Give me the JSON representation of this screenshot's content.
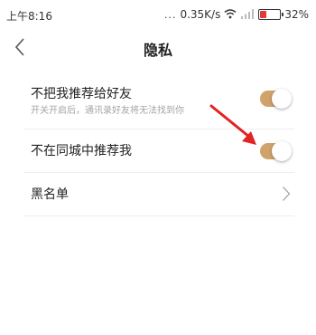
{
  "status_bar": {
    "time": "上午8:16",
    "dots": "...",
    "network_speed": "0.35K/s",
    "battery_percent": "32%",
    "battery_level": 0.32,
    "battery_color": "#e03a3a",
    "icons": [
      "wifi-icon",
      "signal-icon",
      "battery-icon"
    ]
  },
  "nav": {
    "back_icon": "chevron-left-icon",
    "title": "隐私"
  },
  "settings": {
    "items": [
      {
        "label": "不把我推荐给好友",
        "subtitle": "开关开启后，通讯录好友将无法找到你",
        "control": "toggle",
        "on": true
      },
      {
        "label": "不在同城中推荐我",
        "control": "toggle",
        "on": true
      },
      {
        "label": "黑名单",
        "control": "chevron-right-icon"
      }
    ]
  },
  "colors": {
    "toggle_on": "#cfa36a",
    "annotation_arrow": "#e32222",
    "divider": "#eeeeee"
  }
}
